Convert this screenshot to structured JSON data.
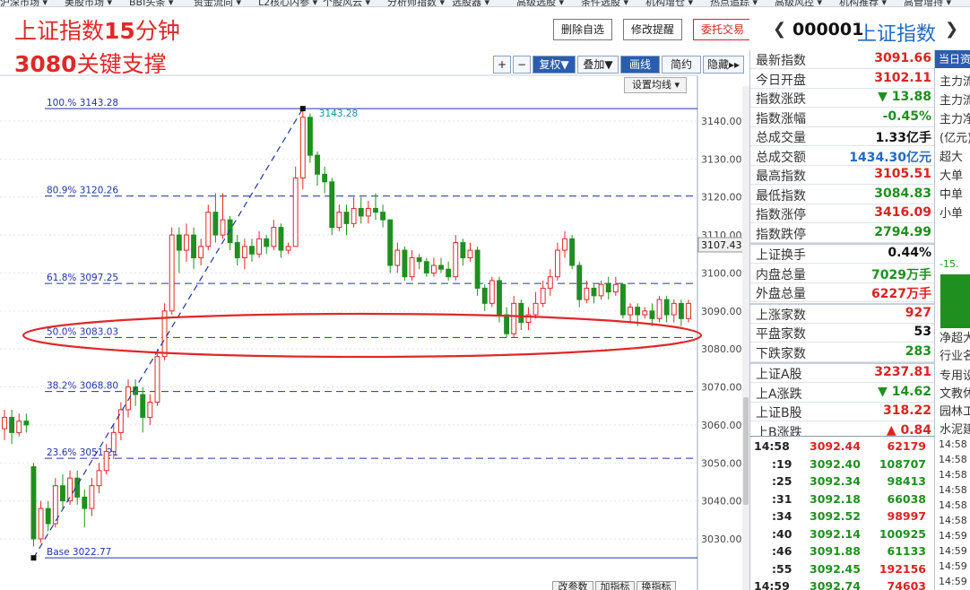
{
  "menu": [
    "沪深市场",
    "美股市场",
    "BBI头条",
    "资金流向",
    "L2核心内参",
    "个股风云",
    "分析师指数",
    "选股器",
    "高级选股",
    "条件选股",
    "机构增仓",
    "热点追踪",
    "高级风控",
    "机构推荐",
    "高管增持"
  ],
  "overlay": {
    "title_line1_a": "上证指数",
    "title_line1_b": "15",
    "title_line1_c": "分钟",
    "title_line2_a": "3080",
    "title_line2_b": "关键支撑"
  },
  "toolbar": {
    "plus": "+",
    "minus": "−",
    "fuquan": "复权▼",
    "diejia": "叠加▼",
    "huaxian": "画线",
    "jianyue": "简约",
    "yincang": "隐藏▸▸",
    "set_ma": "设置均线 ▾"
  },
  "actions": {
    "delete_fav": "删除自选",
    "edit_alert": "修改提醒",
    "trade": "委托交易"
  },
  "bottom_buttons": [
    "改参数",
    "加指标",
    "换指标"
  ],
  "stock": {
    "code": "000001",
    "name": "上证指数"
  },
  "chart_data": {
    "type": "candlestick",
    "title": "",
    "price_axis_ticks": [
      "3140.00",
      "3130.00",
      "3120.00",
      "3110.00",
      "3100.00",
      "3090.00",
      "3080.00",
      "3070.00",
      "3060.00",
      "3050.00",
      "3040.00",
      "3030.00"
    ],
    "current_price_tag": "3107.43",
    "ylim": [
      3027.0,
      3147.0
    ],
    "fib_levels": [
      {
        "label": "100.% 3143.28",
        "value": 3143.28
      },
      {
        "label": "80.9% 3120.26",
        "value": 3120.26
      },
      {
        "label": "61.8% 3097.25",
        "value": 3097.25
      },
      {
        "label": "50.0% 3083.03",
        "value": 3083.03
      },
      {
        "label": "38.2% 3068.80",
        "value": 3068.8
      },
      {
        "label": "23.6% 3051.21",
        "value": 3051.21
      },
      {
        "label": "Base 3022.77",
        "value": 3025.0
      }
    ],
    "peak_label": "3143.28",
    "base_label": "Base 3022.77",
    "colors": {
      "up": "#e02828",
      "down": "#1f8f1f",
      "fib": "#1f35a8",
      "ellipse": "#e02828"
    },
    "candles": [
      [
        3059.0,
        3062.0,
        3056.0,
        3064.0
      ],
      [
        3062.0,
        3058.0,
        3055.0,
        3064.0
      ],
      [
        3058.0,
        3061.0,
        3057.0,
        3063.0
      ],
      [
        3061.0,
        3060.0,
        3058.0,
        3063.0
      ],
      [
        3049.0,
        3030.0,
        3028.0,
        3050.0
      ],
      [
        3030.0,
        3038.0,
        3029.0,
        3040.0
      ],
      [
        3038.0,
        3034.0,
        3032.0,
        3040.0
      ],
      [
        3034.0,
        3044.0,
        3033.0,
        3046.0
      ],
      [
        3044.0,
        3040.0,
        3038.0,
        3047.0
      ],
      [
        3040.0,
        3046.0,
        3039.0,
        3048.0
      ],
      [
        3046.0,
        3041.0,
        3039.0,
        3048.0
      ],
      [
        3041.0,
        3038.0,
        3033.0,
        3043.0
      ],
      [
        3038.0,
        3044.0,
        3036.0,
        3046.0
      ],
      [
        3044.0,
        3048.0,
        3042.0,
        3050.0
      ],
      [
        3048.0,
        3053.0,
        3047.0,
        3055.0
      ],
      [
        3053.0,
        3058.0,
        3051.0,
        3060.0
      ],
      [
        3058.0,
        3064.0,
        3056.0,
        3066.0
      ],
      [
        3064.0,
        3070.0,
        3062.0,
        3072.0
      ],
      [
        3070.0,
        3068.0,
        3065.0,
        3072.0
      ],
      [
        3068.0,
        3062.0,
        3058.0,
        3070.0
      ],
      [
        3062.0,
        3066.0,
        3060.0,
        3068.0
      ],
      [
        3066.0,
        3078.0,
        3065.0,
        3080.0
      ],
      [
        3078.0,
        3090.0,
        3077.0,
        3092.0
      ],
      [
        3090.0,
        3110.0,
        3089.0,
        3112.0
      ],
      [
        3110.0,
        3106.0,
        3100.0,
        3112.0
      ],
      [
        3106.0,
        3110.0,
        3103.0,
        3113.0
      ],
      [
        3110.0,
        3104.0,
        3101.0,
        3112.0
      ],
      [
        3104.0,
        3107.0,
        3102.0,
        3109.0
      ],
      [
        3107.0,
        3116.0,
        3106.0,
        3118.0
      ],
      [
        3116.0,
        3110.0,
        3108.0,
        3121.0
      ],
      [
        3110.0,
        3114.0,
        3109.0,
        3121.0
      ],
      [
        3114.0,
        3108.0,
        3106.0,
        3115.0
      ],
      [
        3108.0,
        3104.0,
        3102.0,
        3110.0
      ],
      [
        3104.0,
        3107.0,
        3101.0,
        3109.0
      ],
      [
        3107.0,
        3105.0,
        3103.0,
        3109.0
      ],
      [
        3105.0,
        3109.0,
        3104.0,
        3111.0
      ],
      [
        3109.0,
        3107.0,
        3105.0,
        3110.0
      ],
      [
        3107.0,
        3112.0,
        3106.0,
        3114.0
      ],
      [
        3112.0,
        3106.0,
        3104.0,
        3113.0
      ],
      [
        3106.0,
        3107.0,
        3105.0,
        3108.0
      ],
      [
        3107.0,
        3125.0,
        3122.0,
        3128.0
      ],
      [
        3125.0,
        3141.0,
        3122.0,
        3143.3
      ],
      [
        3141.0,
        3131.0,
        3129.0,
        3142.0
      ],
      [
        3131.0,
        3126.0,
        3123.0,
        3132.0
      ],
      [
        3126.0,
        3124.0,
        3121.0,
        3128.0
      ],
      [
        3124.0,
        3112.0,
        3110.0,
        3125.0
      ],
      [
        3112.0,
        3116.0,
        3111.0,
        3118.0
      ],
      [
        3116.0,
        3113.0,
        3110.0,
        3118.0
      ],
      [
        3113.0,
        3117.0,
        3112.0,
        3120.0
      ],
      [
        3117.0,
        3115.0,
        3113.0,
        3120.0
      ],
      [
        3115.0,
        3117.0,
        3113.0,
        3119.0
      ],
      [
        3117.0,
        3116.0,
        3114.0,
        3121.0
      ],
      [
        3116.0,
        3114.0,
        3112.0,
        3118.0
      ],
      [
        3114.0,
        3102.0,
        3100.0,
        3109.0
      ],
      [
        3102.0,
        3106.0,
        3100.0,
        3108.0
      ],
      [
        3106.0,
        3099.0,
        3098.0,
        3107.0
      ],
      [
        3099.0,
        3104.0,
        3098.0,
        3106.0
      ],
      [
        3104.0,
        3103.0,
        3101.0,
        3105.0
      ],
      [
        3103.0,
        3100.0,
        3099.0,
        3104.0
      ],
      [
        3100.0,
        3102.0,
        3099.0,
        3104.0
      ],
      [
        3102.0,
        3101.0,
        3100.0,
        3104.0
      ],
      [
        3101.0,
        3099.0,
        3098.0,
        3103.0
      ],
      [
        3099.0,
        3108.0,
        3098.0,
        3110.0
      ],
      [
        3108.0,
        3104.0,
        3102.0,
        3109.0
      ],
      [
        3104.0,
        3106.0,
        3103.0,
        3108.0
      ],
      [
        3106.0,
        3096.0,
        3094.0,
        3107.0
      ],
      [
        3096.0,
        3092.0,
        3090.0,
        3097.0
      ],
      [
        3092.0,
        3098.0,
        3091.0,
        3099.0
      ],
      [
        3098.0,
        3089.0,
        3087.0,
        3099.0
      ],
      [
        3089.0,
        3084.0,
        3083.0,
        3091.0
      ],
      [
        3084.0,
        3092.0,
        3083.0,
        3094.0
      ],
      [
        3092.0,
        3087.0,
        3085.0,
        3093.0
      ],
      [
        3087.0,
        3089.0,
        3085.0,
        3091.0
      ],
      [
        3089.0,
        3092.0,
        3088.0,
        3095.0
      ],
      [
        3092.0,
        3096.0,
        3091.0,
        3098.0
      ],
      [
        3096.0,
        3099.0,
        3094.0,
        3101.0
      ],
      [
        3099.0,
        3106.0,
        3098.0,
        3108.0
      ],
      [
        3106.0,
        3109.0,
        3104.0,
        3111.0
      ],
      [
        3109.0,
        3102.0,
        3101.0,
        3110.0
      ],
      [
        3102.0,
        3093.0,
        3091.0,
        3103.0
      ],
      [
        3093.0,
        3096.0,
        3092.0,
        3098.0
      ],
      [
        3096.0,
        3094.0,
        3092.0,
        3097.0
      ],
      [
        3094.0,
        3097.0,
        3093.0,
        3098.0
      ],
      [
        3097.0,
        3095.0,
        3093.0,
        3099.0
      ],
      [
        3095.0,
        3097.0,
        3094.0,
        3099.0
      ],
      [
        3097.0,
        3089.0,
        3088.0,
        3097.0
      ],
      [
        3089.0,
        3091.0,
        3087.0,
        3092.0
      ],
      [
        3091.0,
        3089.0,
        3086.0,
        3092.0
      ],
      [
        3089.0,
        3090.0,
        3088.0,
        3091.0
      ],
      [
        3090.0,
        3088.0,
        3086.0,
        3092.0
      ],
      [
        3088.0,
        3093.0,
        3087.0,
        3094.0
      ],
      [
        3093.0,
        3089.0,
        3087.0,
        3094.0
      ],
      [
        3089.0,
        3092.0,
        3087.0,
        3093.0
      ],
      [
        3092.0,
        3088.0,
        3086.0,
        3093.0
      ],
      [
        3088.0,
        3092.0,
        3087.0,
        3093.0
      ]
    ]
  },
  "quote": {
    "rows": [
      {
        "label": "最新指数",
        "value": "3091.66",
        "color": "#d22"
      },
      {
        "label": "今日开盘",
        "value": "3102.11",
        "color": "#d22"
      },
      {
        "label": "指数涨跌",
        "value": "▼ 13.88",
        "color": "#1f8f1f"
      },
      {
        "label": "指数涨幅",
        "value": "-0.45%",
        "color": "#1f8f1f"
      },
      {
        "label": "总成交量",
        "value": "1.33亿手",
        "color": "#111"
      },
      {
        "label": "总成交额",
        "value": "1434.30亿元",
        "color": "#2469c8"
      },
      {
        "label": "最高指数",
        "value": "3105.51",
        "color": "#d22"
      },
      {
        "label": "最低指数",
        "value": "3084.83",
        "color": "#1f8f1f"
      },
      {
        "label": "指数涨停",
        "value": "3416.09",
        "color": "#d22"
      },
      {
        "label": "指数跌停",
        "value": "2794.99",
        "color": "#1f8f1f"
      }
    ],
    "rows2": [
      {
        "label": "上证换手",
        "value": "0.44%",
        "color": "#111"
      },
      {
        "label": "内盘总量",
        "value": "7029万手",
        "color": "#1f8f1f"
      },
      {
        "label": "外盘总量",
        "value": "6227万手",
        "color": "#d22"
      }
    ],
    "rows3": [
      {
        "label": "上涨家数",
        "value": "927",
        "color": "#d22"
      },
      {
        "label": "平盘家数",
        "value": "53",
        "color": "#111"
      },
      {
        "label": "下跌家数",
        "value": "283",
        "color": "#1f8f1f"
      }
    ],
    "rows4": [
      {
        "label": "上证A股",
        "value": "3237.81",
        "color": "#d22"
      },
      {
        "label": "上A涨跌",
        "value": "▼ 14.62",
        "color": "#1f8f1f"
      },
      {
        "label": "上证B股",
        "value": "318.22",
        "color": "#d22"
      },
      {
        "label": "上B涨跌",
        "value": "▲ 0.84",
        "color": "#d22"
      }
    ]
  },
  "ticks": [
    {
      "time": "14:58",
      "price": "3092.44",
      "vol": "62179",
      "pcolor": "#d22",
      "vcolor": "#d22"
    },
    {
      "time": ":19",
      "price": "3092.40",
      "vol": "108707",
      "pcolor": "#1f8f1f",
      "vcolor": "#1f8f1f"
    },
    {
      "time": ":25",
      "price": "3092.34",
      "vol": "98413",
      "pcolor": "#1f8f1f",
      "vcolor": "#1f8f1f"
    },
    {
      "time": ":31",
      "price": "3092.18",
      "vol": "66038",
      "pcolor": "#1f8f1f",
      "vcolor": "#1f8f1f"
    },
    {
      "time": ":34",
      "price": "3092.52",
      "vol": "98997",
      "pcolor": "#1f8f1f",
      "vcolor": "#d22"
    },
    {
      "time": ":40",
      "price": "3092.14",
      "vol": "100925",
      "pcolor": "#1f8f1f",
      "vcolor": "#1f8f1f"
    },
    {
      "time": ":46",
      "price": "3091.88",
      "vol": "61133",
      "pcolor": "#1f8f1f",
      "vcolor": "#1f8f1f"
    },
    {
      "time": ":55",
      "price": "3092.45",
      "vol": "192156",
      "pcolor": "#1f8f1f",
      "vcolor": "#d22"
    },
    {
      "time": "14:59",
      "price": "3092.74",
      "vol": "74603",
      "pcolor": "#1f8f1f",
      "vcolor": "#d22"
    }
  ],
  "far_right": {
    "header": "当日资",
    "labels": [
      "主力流",
      "主力流",
      "主力净",
      "(亿元)",
      "超大",
      "大单",
      "中单",
      "小单"
    ],
    "pct": "-15.",
    "net": "净超大",
    "industry": "行业名",
    "stocks": [
      "专用设",
      "文教休",
      "园林工",
      "水泥建"
    ],
    "times": [
      "14:58",
      "14:58",
      "14:58",
      "14:58",
      "14:58",
      "14:58",
      "14:59",
      "14:59",
      "14:59",
      "14:59",
      "14:59"
    ]
  }
}
